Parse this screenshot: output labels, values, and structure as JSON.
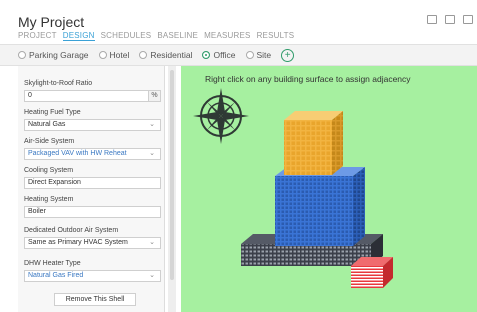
{
  "app": {
    "title": "My Project"
  },
  "tabs": [
    {
      "label": "PROJECT"
    },
    {
      "label": "DESIGN"
    },
    {
      "label": "SCHEDULES"
    },
    {
      "label": "BASELINE"
    },
    {
      "label": "MEASURES"
    },
    {
      "label": "RESULTS"
    }
  ],
  "active_tab": "DESIGN",
  "shells": [
    {
      "label": "Parking Garage",
      "selected": false
    },
    {
      "label": "Hotel",
      "selected": false
    },
    {
      "label": "Residential",
      "selected": false
    },
    {
      "label": "Office",
      "selected": true
    },
    {
      "label": "Site",
      "selected": false
    }
  ],
  "add_shell_symbol": "+",
  "panel": {
    "skylight": {
      "label": "Skylight-to-Roof Ratio",
      "value": "0",
      "unit": "%"
    },
    "heating_fuel": {
      "label": "Heating Fuel Type",
      "value": "Natural Gas"
    },
    "air_side": {
      "label": "Air-Side System",
      "value": "Packaged VAV with HW Reheat"
    },
    "cooling": {
      "label": "Cooling System",
      "value": "Direct Expansion"
    },
    "heating": {
      "label": "Heating System",
      "value": "Boiler"
    },
    "doas": {
      "label": "Dedicated Outdoor Air System",
      "value": "Same as Primary HVAC System"
    },
    "dhw": {
      "label": "DHW Heater Type",
      "value": "Natural Gas Fired"
    },
    "remove_label": "Remove This Shell"
  },
  "viewport": {
    "hint": "Right click on any building surface to assign adjacency",
    "background": "#a6f0a0",
    "colors": {
      "top_block": "#f2b441",
      "tower": "#3a74d6",
      "podium": "#3b3f4a",
      "annex": "#e8383c"
    }
  },
  "icons": {
    "compass": "compass-rose-icon",
    "chevron": "chevron-down-icon"
  },
  "accent": "#3aa1d6",
  "selected_color": "#2f9b6a"
}
